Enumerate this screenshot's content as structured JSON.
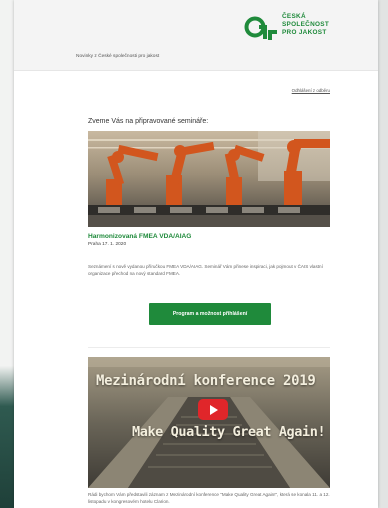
{
  "brand": {
    "name_lines": [
      "ČESKÁ",
      "SPOLEČNOST",
      "PRO JAKOST"
    ],
    "color": "#1f8a3b"
  },
  "header": {
    "tagline": "Novinky z České společnosti pro jakost"
  },
  "links": {
    "unsubscribe": "Odhlášení z odběru"
  },
  "intro": "Zveme Vás na připravované semináře:",
  "event": {
    "title": "Harmonizovaná FMEA VDA/AIAG",
    "date": "Praha 17. 1. 2020",
    "description": "Seznámení s nově vydanou příručkou FMEA VDA/AIAG. Seminář Vám přinese inspiraci, jak  pojmout v ČAIS vlastní organizace přechod na nový standard FMEA.",
    "cta_label": "Program a možnost přihlášení"
  },
  "video": {
    "title_line1": "Mezinárodní konference 2019",
    "title_line2": "Make Quality Great Again!",
    "play_icon": "play-icon",
    "description": "Rádi bychom Vám představili záznam z Mezinárodní konference \"Make Quality Great Again!\", která se konala 11. a 12. listopadu v kongresovém hotelu Clarion."
  }
}
